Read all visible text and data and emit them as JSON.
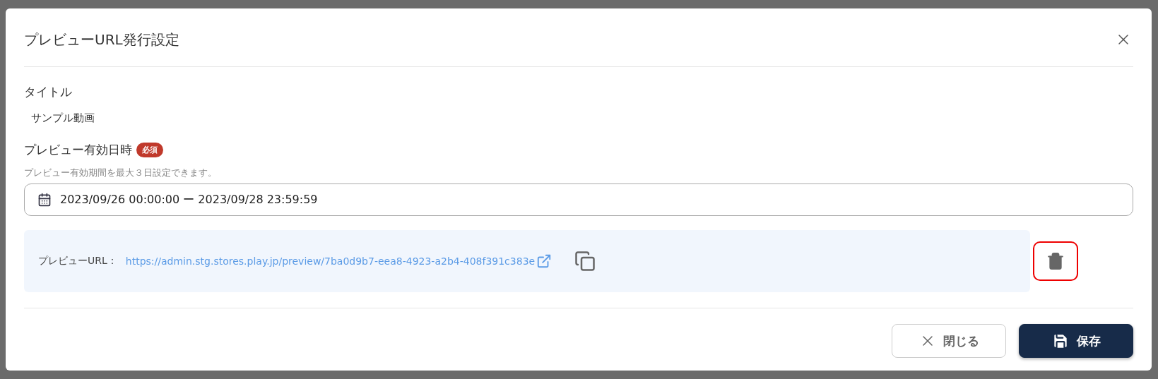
{
  "dialog": {
    "title": "プレビューURL発行設定"
  },
  "fields": [
    {
      "kind": "text",
      "label": "タイトル",
      "value": "サンプル動画"
    },
    {
      "kind": "daterange",
      "label": "プレビュー有効日時",
      "badge": "必須",
      "hint": "プレビュー有効期間を最大３日設定できます。",
      "value": "2023/09/26 00:00:00 ー 2023/09/28 23:59:59"
    }
  ],
  "preview_url": {
    "label": "プレビューURL：",
    "url": "https://admin.stg.stores.play.jp/preview/7ba0d9b7-eea8-4923-a2b4-408f391c383e",
    "delete_highlighted": true
  },
  "buttons": [
    {
      "kind": "secondary",
      "label": "閉じる"
    },
    {
      "kind": "primary",
      "label": "保存"
    }
  ]
}
